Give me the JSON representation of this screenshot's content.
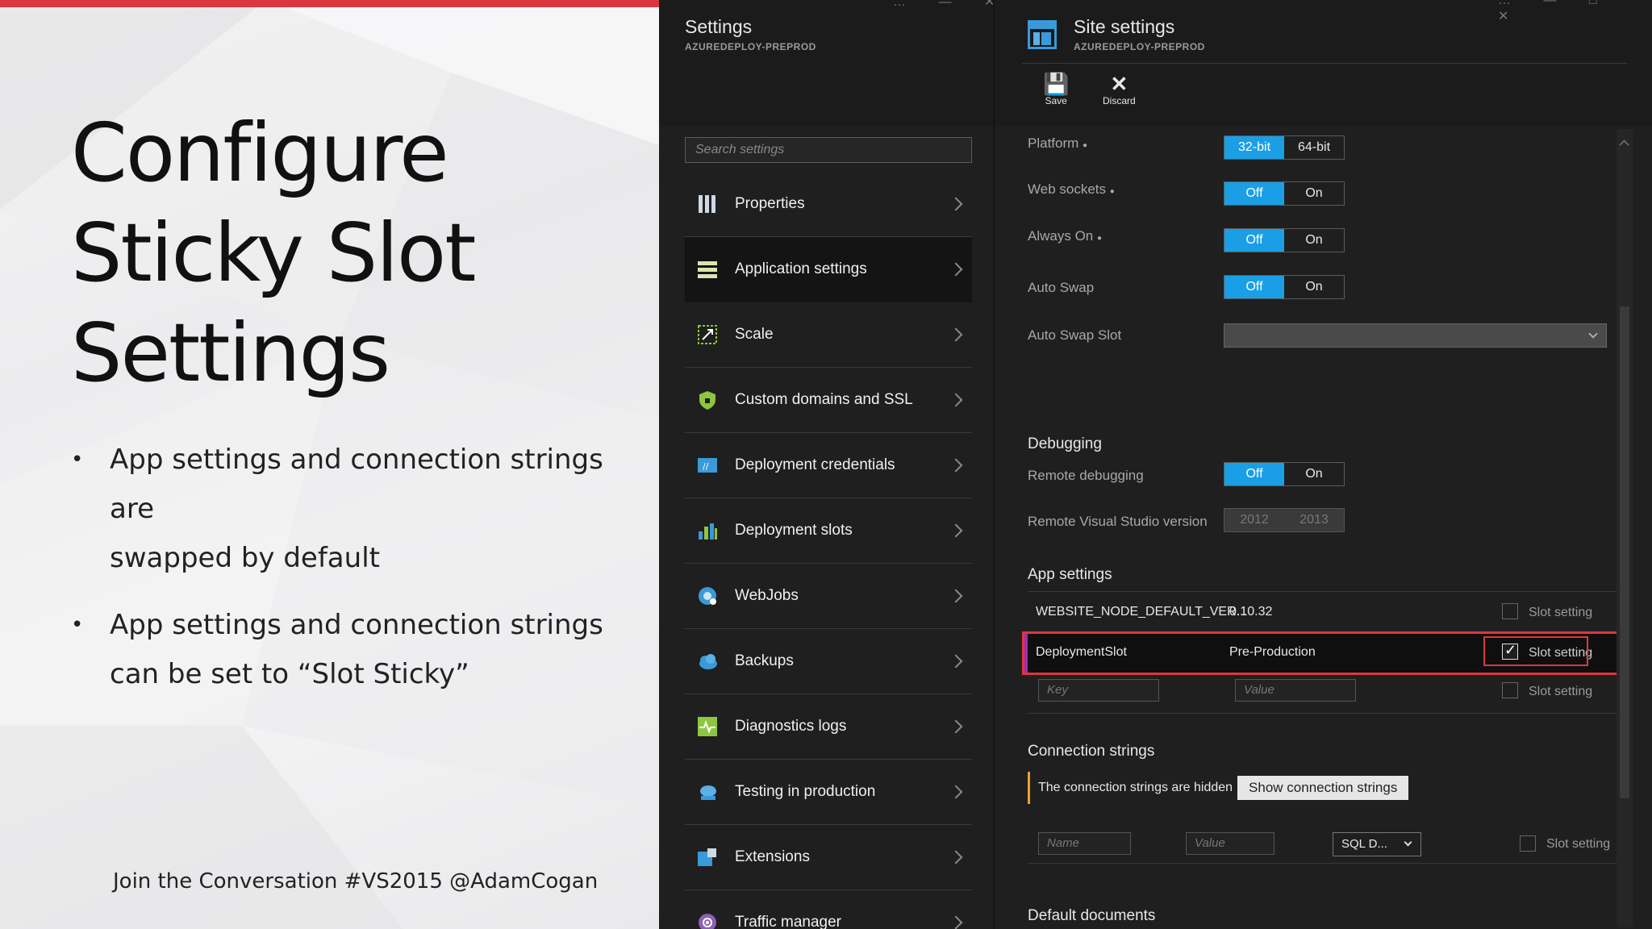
{
  "slide": {
    "title_lines": [
      "Configure",
      "Sticky Slot",
      "Settings"
    ],
    "bullets": [
      {
        "line1": "App settings and connection strings are",
        "line2": "swapped by default"
      },
      {
        "line1": "App settings and connection strings",
        "line2": "can be set to “Slot Sticky”"
      }
    ],
    "footer": "Join the Conversation #VS2015 @AdamCogan",
    "accent_color": "#d9393e"
  },
  "settings_blade": {
    "title": "Settings",
    "subtitle": "AZUREDEPLOY-PREPROD",
    "window_controls": "… — ✕",
    "search_placeholder": "Search settings",
    "items": [
      {
        "label": "Properties",
        "icon": "properties-icon"
      },
      {
        "label": "Application settings",
        "icon": "application-settings-icon",
        "active": true
      },
      {
        "label": "Scale",
        "icon": "scale-icon"
      },
      {
        "label": "Custom domains and SSL",
        "icon": "shield-icon"
      },
      {
        "label": "Deployment credentials",
        "icon": "credentials-icon"
      },
      {
        "label": "Deployment slots",
        "icon": "deployment-slots-icon"
      },
      {
        "label": "WebJobs",
        "icon": "webjobs-icon"
      },
      {
        "label": "Backups",
        "icon": "cloud-icon"
      },
      {
        "label": "Diagnostics logs",
        "icon": "diagnostics-icon"
      },
      {
        "label": "Testing in production",
        "icon": "testing-icon"
      },
      {
        "label": "Extensions",
        "icon": "extensions-icon"
      },
      {
        "label": "Traffic manager",
        "icon": "traffic-manager-icon"
      }
    ]
  },
  "site_blade": {
    "title": "Site settings",
    "subtitle": "AZUREDEPLOY-PREPROD",
    "window_controls": "… — □ ✕",
    "toolbar": {
      "save": "Save",
      "discard": "Discard"
    },
    "platform": {
      "label": "Platform",
      "options": [
        "32-bit",
        "64-bit"
      ],
      "selected": "32-bit"
    },
    "web_sockets": {
      "label": "Web sockets",
      "options": [
        "Off",
        "On"
      ],
      "selected": "Off"
    },
    "always_on": {
      "label": "Always On",
      "options": [
        "Off",
        "On"
      ],
      "selected": "Off"
    },
    "auto_swap": {
      "label": "Auto Swap",
      "options": [
        "Off",
        "On"
      ],
      "selected": "Off"
    },
    "auto_swap_slot": {
      "label": "Auto Swap Slot",
      "value": ""
    },
    "debugging": {
      "title": "Debugging",
      "remote_debugging": {
        "label": "Remote debugging",
        "options": [
          "Off",
          "On"
        ],
        "selected": "Off"
      },
      "vs_version": {
        "label": "Remote Visual Studio version",
        "options": [
          "2012",
          "2013"
        ]
      }
    },
    "app_settings": {
      "title": "App settings",
      "slot_label": "Slot setting",
      "rows": [
        {
          "key": "WEBSITE_NODE_DEFAULT_VER...",
          "value": "0.10.32",
          "sticky": false
        },
        {
          "key": "DeploymentSlot",
          "value": "Pre-Production",
          "sticky": true
        }
      ],
      "key_placeholder": "Key",
      "value_placeholder": "Value"
    },
    "connection_strings": {
      "title": "Connection strings",
      "hidden_text": "The connection strings are hidden",
      "show_button": "Show connection strings",
      "name_placeholder": "Name",
      "value_placeholder": "Value",
      "type": "SQL D...",
      "slot_label": "Slot setting"
    },
    "default_documents": {
      "title": "Default documents"
    }
  }
}
